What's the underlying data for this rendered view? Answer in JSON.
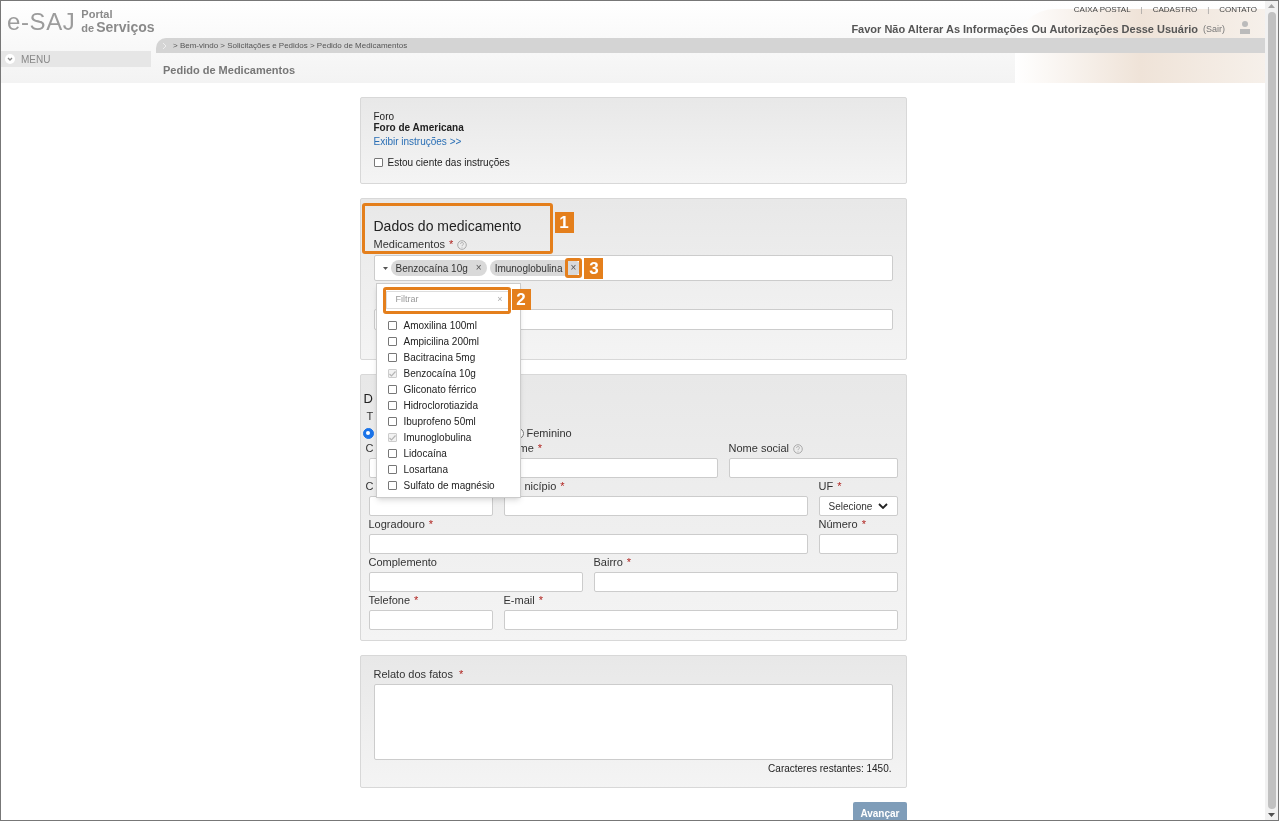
{
  "header": {
    "logo": "e-SAJ",
    "portal_top": "Portal",
    "portal_de": "de",
    "portal_name": "Serviços",
    "top_links": [
      {
        "kind": "link",
        "text": "CAIXA POSTAL"
      },
      {
        "kind": "separator",
        "text": "|"
      },
      {
        "kind": "link",
        "text": "CADASTRO"
      },
      {
        "kind": "separator",
        "text": "|"
      },
      {
        "kind": "link",
        "text": "CONTATO"
      }
    ],
    "user_notice": "Favor Não Alterar As Informações Ou Autorizações Desse Usuário",
    "logout": "(Sair)",
    "breadcrumb": "> Bem-vindo > Solicitações e Pedidos > Pedido de Medicamentos",
    "menu": "MENU",
    "page_title": "Pedido de Medicamentos"
  },
  "foro_section": {
    "label": "Foro",
    "value": "Foro de Americana",
    "instructions_link": "Exibir instruções >>",
    "acknowledge": {
      "label": "Estou ciente das instruções",
      "checked": false
    }
  },
  "medication_section": {
    "title": "Dados do medicamento",
    "field_label": "Medicamentos",
    "required_mark": "*",
    "chips": [
      {
        "text": "Benzocaína 10g",
        "remove": "×"
      },
      {
        "text": "Imunoglobulina",
        "remove": "×"
      }
    ],
    "dropdown": {
      "filter_placeholder": "Filtrar",
      "clear": "×",
      "options": [
        {
          "label": "Amoxilina 100ml",
          "checked": false
        },
        {
          "label": "Ampicilina 200ml",
          "checked": false
        },
        {
          "label": "Bacitracina 5mg",
          "checked": false
        },
        {
          "label": "Benzocaína 10g",
          "checked": true
        },
        {
          "label": "Gliconato férrico",
          "checked": false
        },
        {
          "label": "Hidroclorotiazida",
          "checked": false
        },
        {
          "label": "Ibuprofeno 50ml",
          "checked": false
        },
        {
          "label": "Imunoglobulina",
          "checked": true
        },
        {
          "label": "Lidocaína",
          "checked": false
        },
        {
          "label": "Losartana",
          "checked": false
        },
        {
          "label": "Sulfato de magnésio",
          "checked": false
        }
      ]
    }
  },
  "personal_section": {
    "title": "D",
    "type_label": "T",
    "radio_options": [
      {
        "selected": true
      },
      {
        "label": "Feminino",
        "selected": false
      }
    ],
    "rows": [
      [
        {
          "kind": "text",
          "label": "C"
        },
        {
          "kind": "text",
          "label": "me",
          "required_mark": "*"
        },
        {
          "kind": "text",
          "label": "Nome social",
          "help": true
        }
      ],
      [
        {
          "kind": "text",
          "label": "C"
        },
        {
          "kind": "text",
          "label": "nicípio",
          "required_mark": "*"
        },
        {
          "kind": "select",
          "label": "UF",
          "required_mark": "*",
          "value": "Selecione"
        }
      ],
      [
        {
          "kind": "text",
          "label": "Logradouro",
          "required_mark": "*"
        },
        {
          "kind": "text",
          "label": "Número",
          "required_mark": "*"
        }
      ],
      [
        {
          "kind": "text",
          "label": "Complemento"
        },
        {
          "kind": "text",
          "label": "Bairro",
          "required_mark": "*"
        }
      ],
      [
        {
          "kind": "text",
          "label": "Telefone",
          "required_mark": "*"
        },
        {
          "kind": "text",
          "label": "E-mail",
          "required_mark": "*"
        }
      ]
    ]
  },
  "facts_section": {
    "label": "Relato dos fatos",
    "required_mark": "*",
    "counter": "Caracteres restantes: 1450."
  },
  "submit_button": "Avançar",
  "annotations": [
    {
      "number": "1"
    },
    {
      "number": "2"
    },
    {
      "number": "3"
    }
  ]
}
